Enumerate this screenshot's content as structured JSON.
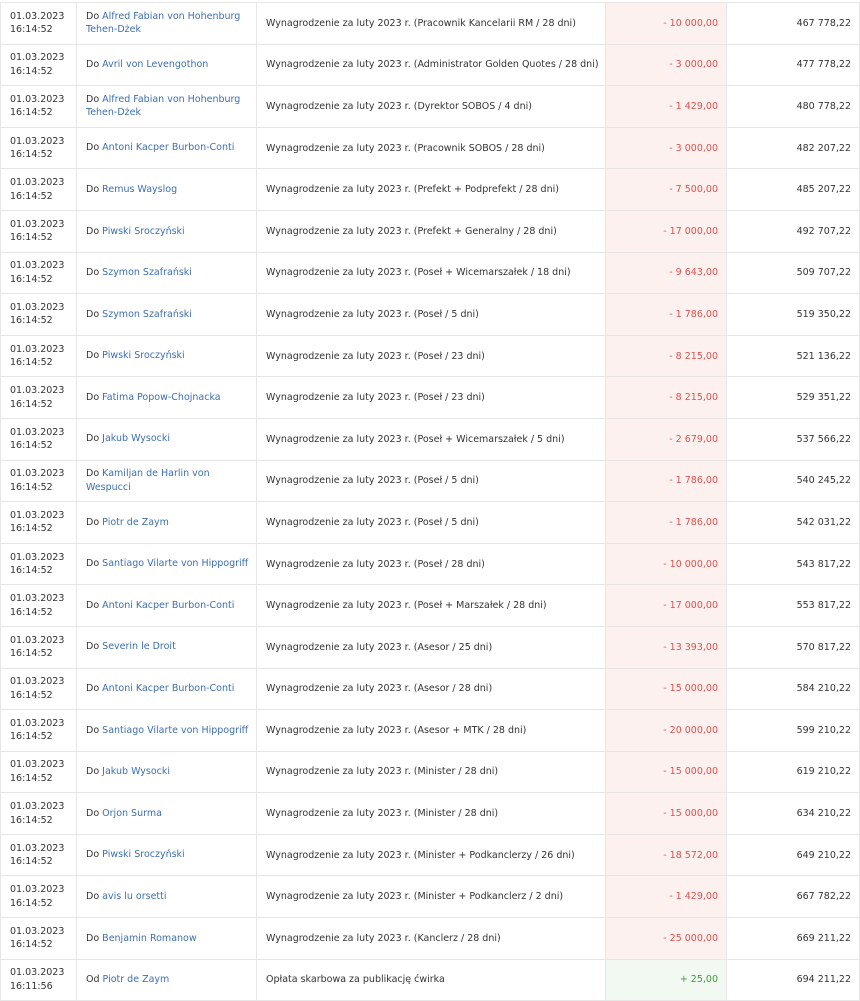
{
  "colors": {
    "link": "#3d6fb0",
    "negative": "#d9534f",
    "negative_bg": "#fdf1ef",
    "positive": "#3c9a3c",
    "positive_bg": "#f2f9f2"
  },
  "transactions": [
    {
      "date": "01.03.2023",
      "time": "16:14:52",
      "dir": "Do",
      "party": "Alfred Fabian von Hohenburg Tehen-Dżek",
      "title": "Wynagrodzenie za luty 2023 r. (Pracownik Kancelarii RM / 28 dni)",
      "amount": "- 10 000,00",
      "sign": "neg",
      "balance": "467 778,22"
    },
    {
      "date": "01.03.2023",
      "time": "16:14:52",
      "dir": "Do",
      "party": "Avril von Levengothon",
      "title": "Wynagrodzenie za luty 2023 r. (Administrator Golden Quotes / 28 dni)",
      "amount": "- 3 000,00",
      "sign": "neg",
      "balance": "477 778,22"
    },
    {
      "date": "01.03.2023",
      "time": "16:14:52",
      "dir": "Do",
      "party": "Alfred Fabian von Hohenburg Tehen-Dżek",
      "title": "Wynagrodzenie za luty 2023 r. (Dyrektor SOBOS / 4 dni)",
      "amount": "- 1 429,00",
      "sign": "neg",
      "balance": "480 778,22"
    },
    {
      "date": "01.03.2023",
      "time": "16:14:52",
      "dir": "Do",
      "party": "Antoni Kacper Burbon-Conti",
      "title": "Wynagrodzenie za luty 2023 r. (Pracownik SOBOS / 28 dni)",
      "amount": "- 3 000,00",
      "sign": "neg",
      "balance": "482 207,22"
    },
    {
      "date": "01.03.2023",
      "time": "16:14:52",
      "dir": "Do",
      "party": "Remus Wayslog",
      "title": "Wynagrodzenie za luty 2023 r. (Prefekt + Podprefekt / 28 dni)",
      "amount": "- 7 500,00",
      "sign": "neg",
      "balance": "485 207,22"
    },
    {
      "date": "01.03.2023",
      "time": "16:14:52",
      "dir": "Do",
      "party": "Piwski Sroczyński",
      "title": "Wynagrodzenie za luty 2023 r. (Prefekt + Generalny / 28 dni)",
      "amount": "- 17 000,00",
      "sign": "neg",
      "balance": "492 707,22"
    },
    {
      "date": "01.03.2023",
      "time": "16:14:52",
      "dir": "Do",
      "party": "Szymon Szafrański",
      "title": "Wynagrodzenie za luty 2023 r. (Poseł + Wicemarszałek / 18 dni)",
      "amount": "- 9 643,00",
      "sign": "neg",
      "balance": "509 707,22"
    },
    {
      "date": "01.03.2023",
      "time": "16:14:52",
      "dir": "Do",
      "party": "Szymon Szafrański",
      "title": "Wynagrodzenie za luty 2023 r. (Poseł / 5 dni)",
      "amount": "- 1 786,00",
      "sign": "neg",
      "balance": "519 350,22"
    },
    {
      "date": "01.03.2023",
      "time": "16:14:52",
      "dir": "Do",
      "party": "Piwski Sroczyński",
      "title": "Wynagrodzenie za luty 2023 r. (Poseł / 23 dni)",
      "amount": "- 8 215,00",
      "sign": "neg",
      "balance": "521 136,22"
    },
    {
      "date": "01.03.2023",
      "time": "16:14:52",
      "dir": "Do",
      "party": "Fatima Popow-Chojnacka",
      "title": "Wynagrodzenie za luty 2023 r. (Poseł / 23 dni)",
      "amount": "- 8 215,00",
      "sign": "neg",
      "balance": "529 351,22"
    },
    {
      "date": "01.03.2023",
      "time": "16:14:52",
      "dir": "Do",
      "party": "Jakub Wysocki",
      "title": "Wynagrodzenie za luty 2023 r. (Poseł + Wicemarszałek / 5 dni)",
      "amount": "- 2 679,00",
      "sign": "neg",
      "balance": "537 566,22"
    },
    {
      "date": "01.03.2023",
      "time": "16:14:52",
      "dir": "Do",
      "party": "Kamiljan de Harlin von Wespucci",
      "title": "Wynagrodzenie za luty 2023 r. (Poseł / 5 dni)",
      "amount": "- 1 786,00",
      "sign": "neg",
      "balance": "540 245,22"
    },
    {
      "date": "01.03.2023",
      "time": "16:14:52",
      "dir": "Do",
      "party": "Piotr de Zaym",
      "title": "Wynagrodzenie za luty 2023 r. (Poseł / 5 dni)",
      "amount": "- 1 786,00",
      "sign": "neg",
      "balance": "542 031,22"
    },
    {
      "date": "01.03.2023",
      "time": "16:14:52",
      "dir": "Do",
      "party": "Santiago Vilarte von Hippogriff",
      "title": "Wynagrodzenie za luty 2023 r. (Poseł / 28 dni)",
      "amount": "- 10 000,00",
      "sign": "neg",
      "balance": "543 817,22"
    },
    {
      "date": "01.03.2023",
      "time": "16:14:52",
      "dir": "Do",
      "party": "Antoni Kacper Burbon-Conti",
      "title": "Wynagrodzenie za luty 2023 r. (Poseł + Marszałek / 28 dni)",
      "amount": "- 17 000,00",
      "sign": "neg",
      "balance": "553 817,22"
    },
    {
      "date": "01.03.2023",
      "time": "16:14:52",
      "dir": "Do",
      "party": "Severin le Droit",
      "title": "Wynagrodzenie za luty 2023 r. (Asesor / 25 dni)",
      "amount": "- 13 393,00",
      "sign": "neg",
      "balance": "570 817,22"
    },
    {
      "date": "01.03.2023",
      "time": "16:14:52",
      "dir": "Do",
      "party": "Antoni Kacper Burbon-Conti",
      "title": "Wynagrodzenie za luty 2023 r. (Asesor / 28 dni)",
      "amount": "- 15 000,00",
      "sign": "neg",
      "balance": "584 210,22"
    },
    {
      "date": "01.03.2023",
      "time": "16:14:52",
      "dir": "Do",
      "party": "Santiago Vilarte von Hippogriff",
      "title": "Wynagrodzenie za luty 2023 r. (Asesor + MTK / 28 dni)",
      "amount": "- 20 000,00",
      "sign": "neg",
      "balance": "599 210,22"
    },
    {
      "date": "01.03.2023",
      "time": "16:14:52",
      "dir": "Do",
      "party": "Jakub Wysocki",
      "title": "Wynagrodzenie za luty 2023 r. (Minister / 28 dni)",
      "amount": "- 15 000,00",
      "sign": "neg",
      "balance": "619 210,22"
    },
    {
      "date": "01.03.2023",
      "time": "16:14:52",
      "dir": "Do",
      "party": "Orjon Surma",
      "title": "Wynagrodzenie za luty 2023 r. (Minister / 28 dni)",
      "amount": "- 15 000,00",
      "sign": "neg",
      "balance": "634 210,22"
    },
    {
      "date": "01.03.2023",
      "time": "16:14:52",
      "dir": "Do",
      "party": "Piwski Sroczyński",
      "title": "Wynagrodzenie za luty 2023 r. (Minister + Podkanclerzy / 26 dni)",
      "amount": "- 18 572,00",
      "sign": "neg",
      "balance": "649 210,22"
    },
    {
      "date": "01.03.2023",
      "time": "16:14:52",
      "dir": "Do",
      "party": "avis lu orsetti",
      "title": "Wynagrodzenie za luty 2023 r. (Minister + Podkanclerz / 2 dni)",
      "amount": "- 1 429,00",
      "sign": "neg",
      "balance": "667 782,22"
    },
    {
      "date": "01.03.2023",
      "time": "16:14:52",
      "dir": "Do",
      "party": "Benjamin Romanow",
      "title": "Wynagrodzenie za luty 2023 r. (Kanclerz / 28 dni)",
      "amount": "- 25 000,00",
      "sign": "neg",
      "balance": "669 211,22"
    },
    {
      "date": "01.03.2023",
      "time": "16:11:56",
      "dir": "Od",
      "party": "Piotr de Zaym",
      "title": "Opłata skarbowa za publikację ćwirka",
      "amount": "+ 25,00",
      "sign": "pos",
      "balance": "694 211,22"
    }
  ]
}
